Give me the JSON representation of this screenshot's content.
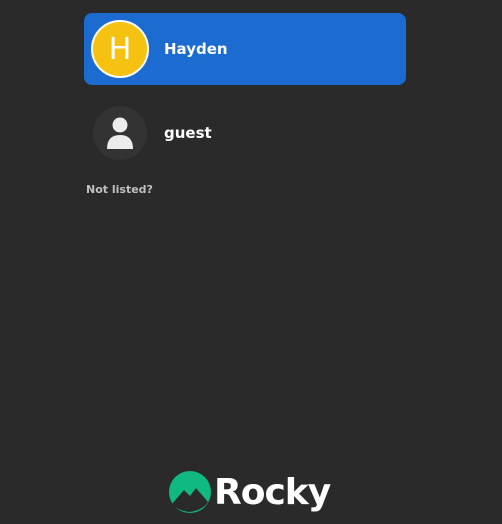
{
  "users": [
    {
      "initial": "H",
      "name": "Hayden",
      "selected": true,
      "avatar_color": "#f5c211"
    },
    {
      "initial": "",
      "name": "guest",
      "selected": false,
      "avatar_icon": "person-icon"
    }
  ],
  "not_listed_label": "Not listed?",
  "branding": {
    "logo_text": "Rocky",
    "logo_icon": "rocky-mountain-icon",
    "accent_color": "#10b981"
  },
  "colors": {
    "background": "#2a2a2a",
    "selection": "#1c6bd1"
  }
}
